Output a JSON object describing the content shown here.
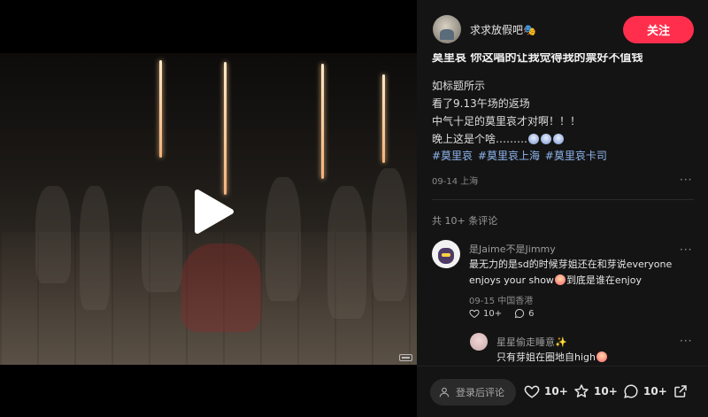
{
  "video": {
    "play_icon": "play-icon",
    "quality_icon": "hd-icon"
  },
  "author": {
    "name": "求求放假吧🎭",
    "follow_label": "关注"
  },
  "post": {
    "title": "莫里哀 你这唱的让我觉得我的票好不值钱",
    "body": [
      "如标题所示",
      "看了9.13午场的返场",
      "中气十足的莫里哀才对啊！！！",
      "晚上这是个啥………"
    ],
    "tags": [
      "#莫里哀",
      "#莫里哀上海",
      "#莫里哀卡司"
    ],
    "time": "09-14 上海",
    "more": "···"
  },
  "comments": {
    "count_label": "共 10+ 条评论",
    "items": [
      {
        "user": "是Jaime不是Jimmy",
        "text_line1": "最无力的是sd的时候芽姐还在和芽说everyone",
        "text_line2_a": "enjoys your show",
        "text_line2_b": "到底是谁在enjoy",
        "meta": "09-15 中国香港",
        "likes": "10+",
        "replies": "6",
        "more": "···"
      },
      {
        "user": "星星偷走睡意✨",
        "text": "只有芽姐在圈地自high",
        "more": "···"
      }
    ]
  },
  "bottom_bar": {
    "comment_placeholder": "登录后评论",
    "likes": "10+",
    "favorites": "10+",
    "comments": "10+"
  }
}
